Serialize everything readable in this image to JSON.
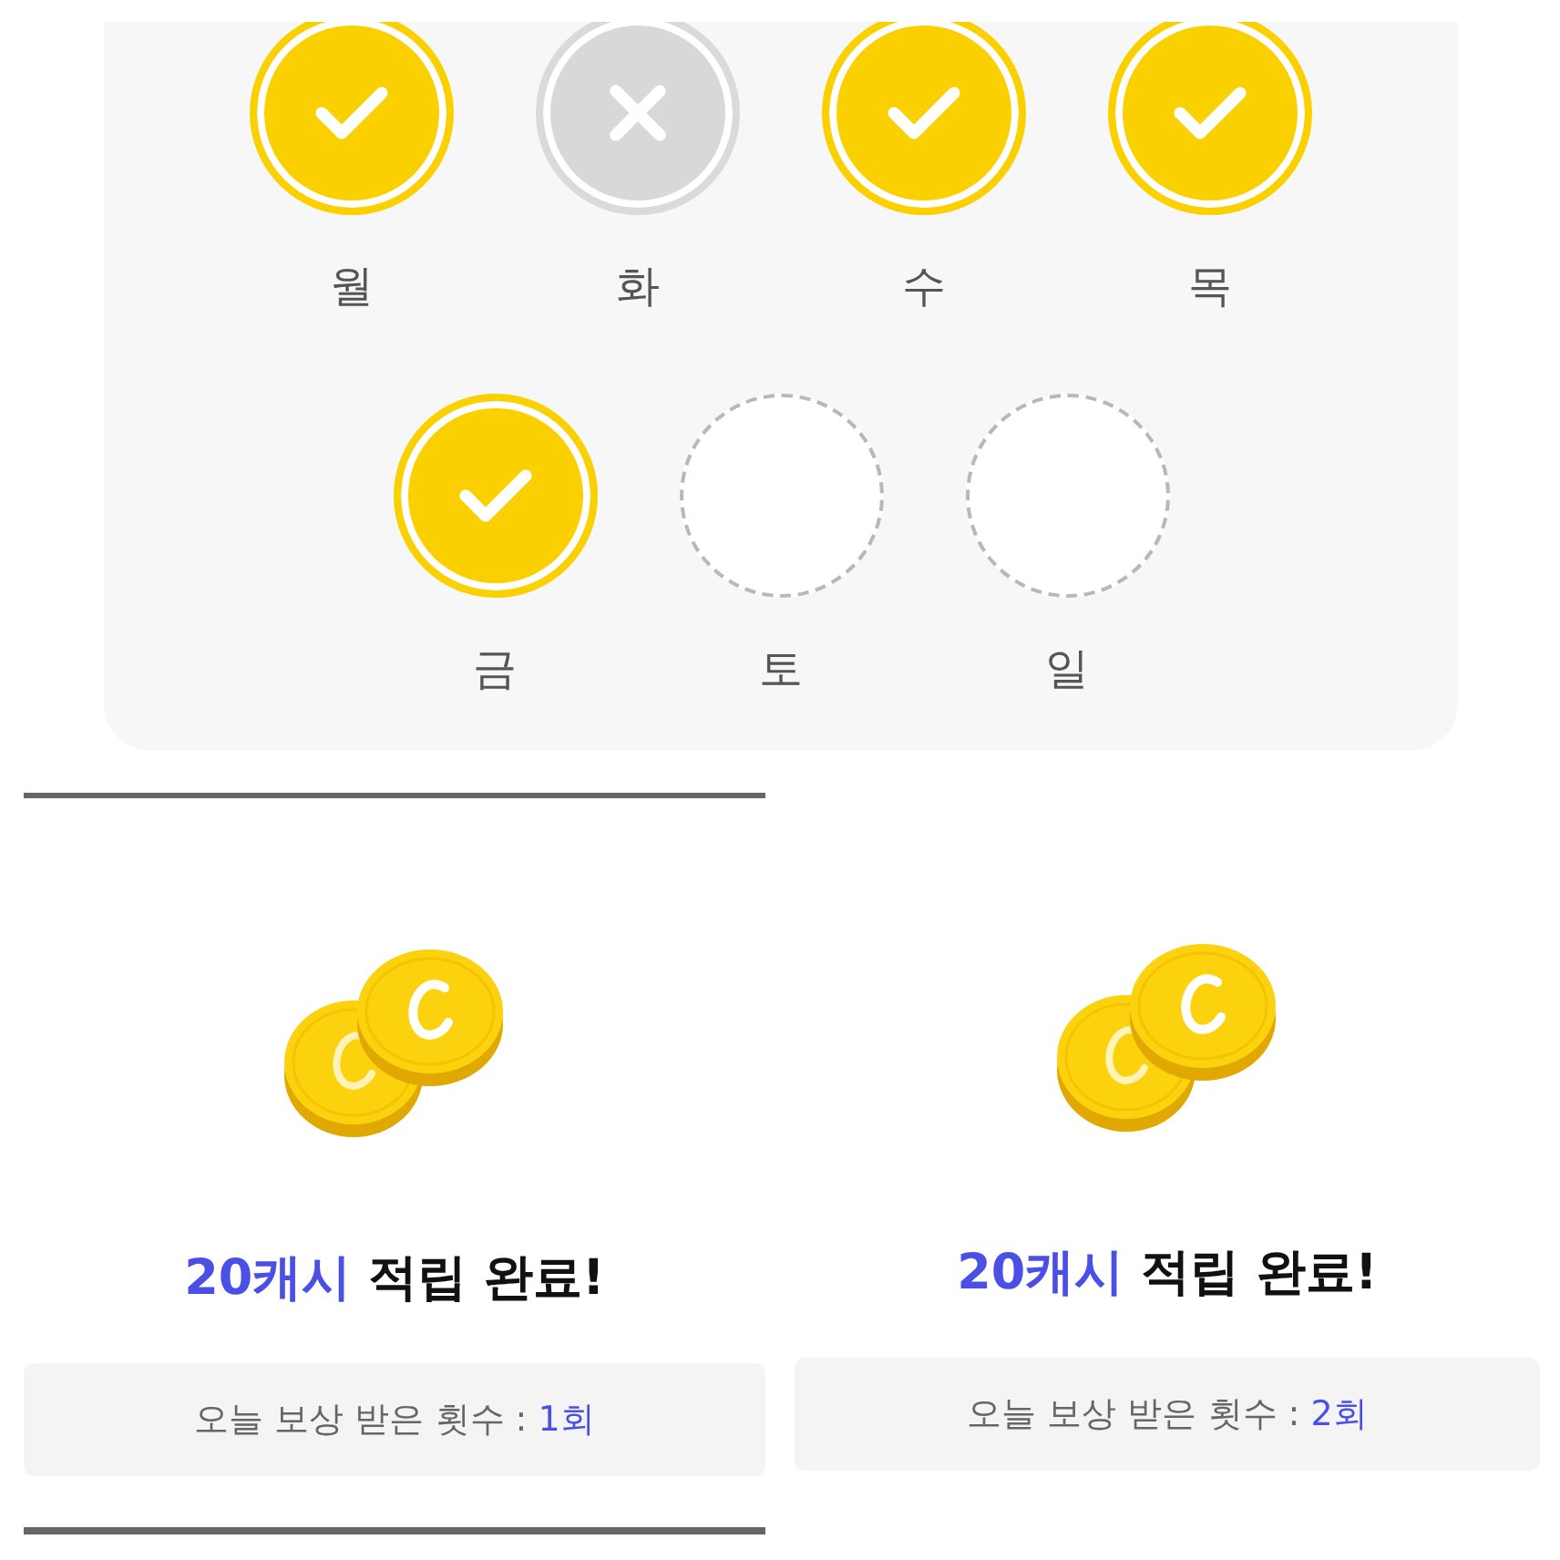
{
  "week": {
    "days": [
      {
        "label": "월",
        "kind": "checked"
      },
      {
        "label": "화",
        "kind": "missed"
      },
      {
        "label": "수",
        "kind": "checked"
      },
      {
        "label": "목",
        "kind": "checked"
      },
      {
        "label": "금",
        "kind": "checked"
      },
      {
        "label": "토",
        "kind": "empty"
      },
      {
        "label": "일",
        "kind": "empty"
      }
    ]
  },
  "rewards": [
    {
      "amount": "20캐시",
      "title_rest": "적립 완료!",
      "count_label": "오늘 보상 받은 횟수 :",
      "count": "1회",
      "framed": true
    },
    {
      "amount": "20캐시",
      "title_rest": "적립 완료!",
      "count_label": "오늘 보상 받은 횟수 :",
      "count": "2회",
      "framed": false
    }
  ]
}
